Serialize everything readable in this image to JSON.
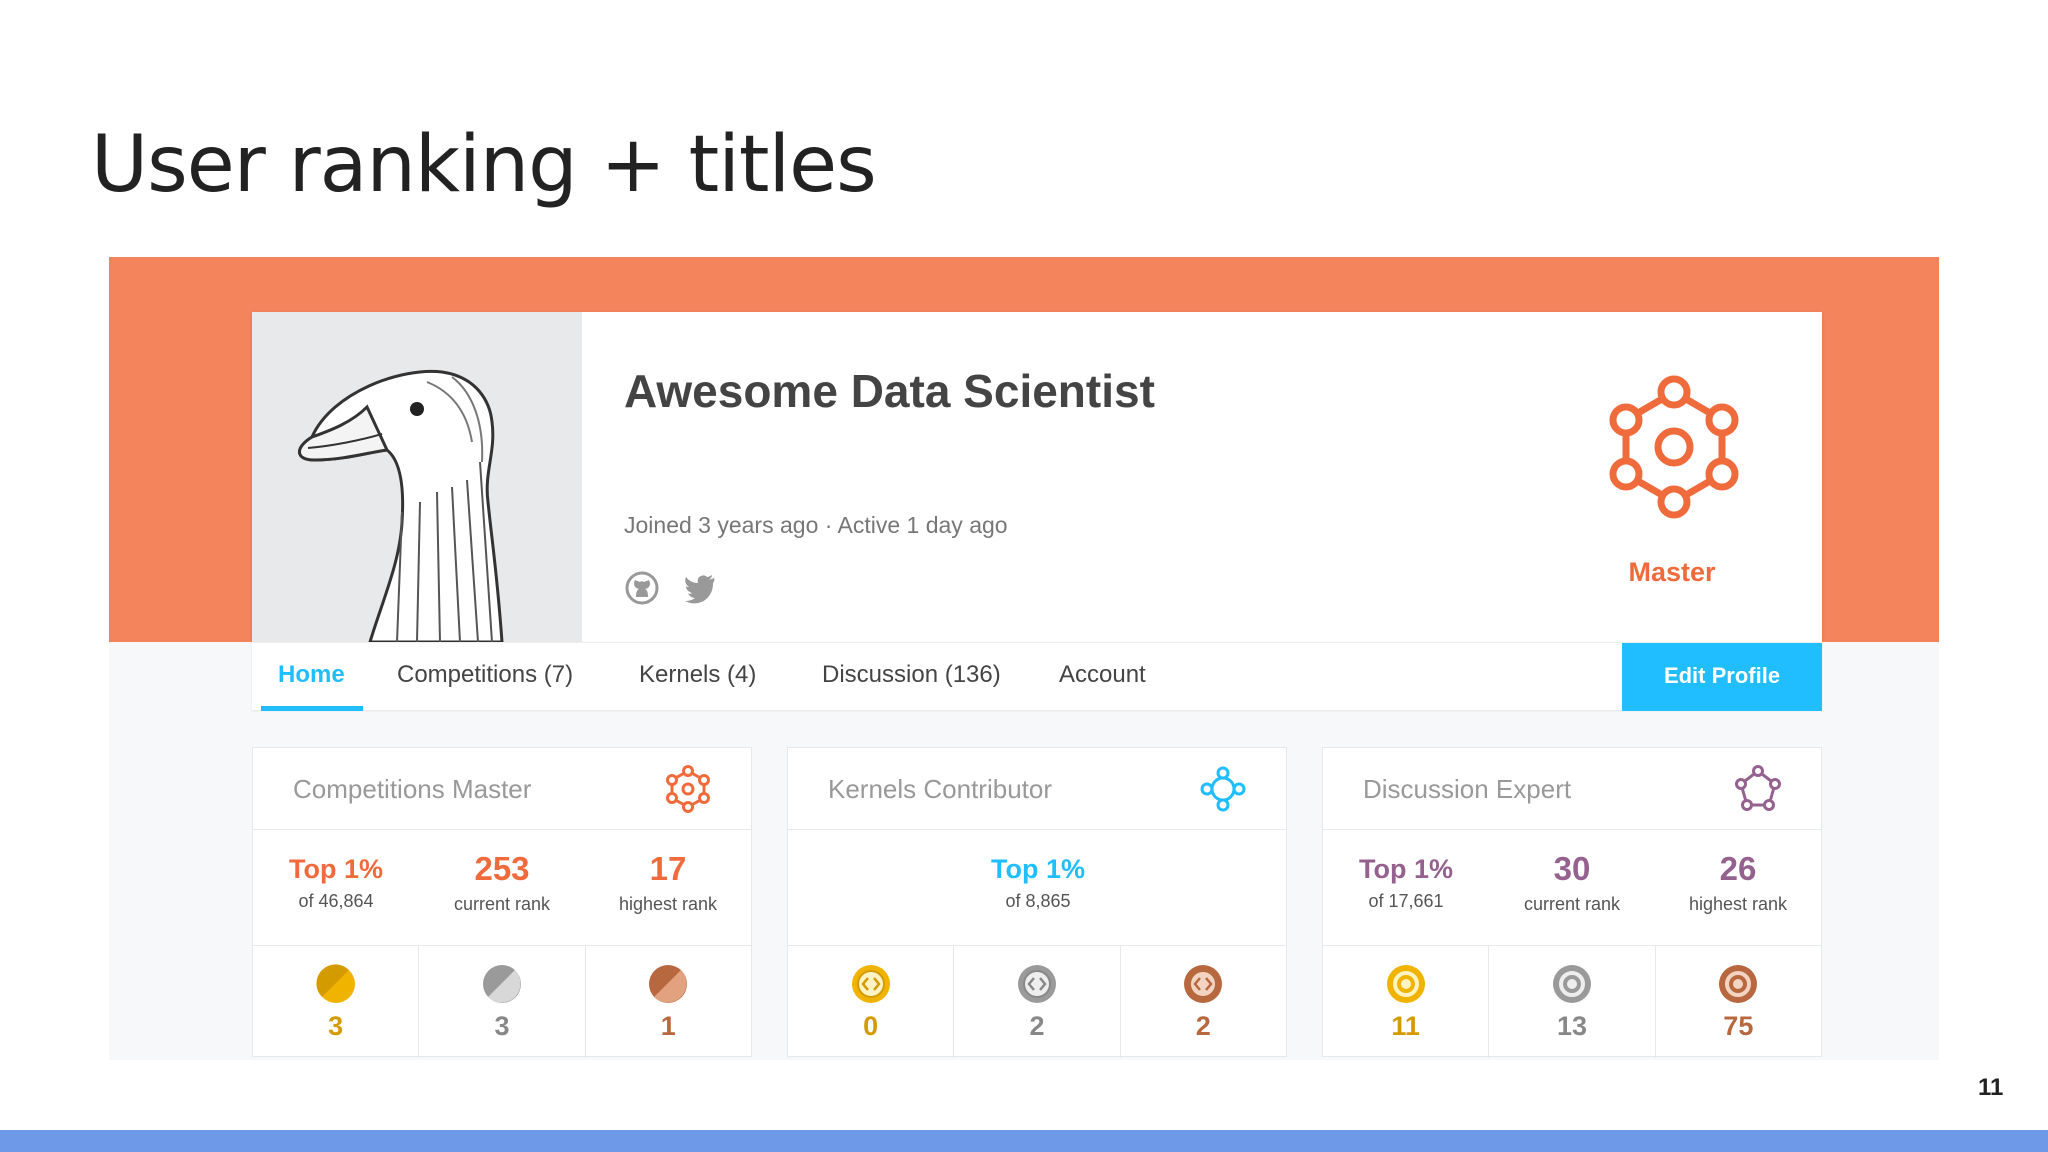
{
  "slide": {
    "title": "User ranking + titles",
    "page_number": "11"
  },
  "profile": {
    "name": "Awesome Data Scientist",
    "meta": "Joined 3 years ago · Active 1 day ago",
    "tier_label": "Master",
    "social_icons": [
      "github-icon",
      "twitter-icon"
    ]
  },
  "nav": {
    "items": [
      "Home",
      "Competitions (7)",
      "Kernels (4)",
      "Discussion (136)",
      "Account"
    ],
    "edit_label": "Edit Profile"
  },
  "colors": {
    "orange": "#f06b3c",
    "blue": "#20beff",
    "purple": "#95628f",
    "gold": "#f0b400",
    "silver": "#9a9a9a",
    "bronze": "#d07a4e"
  },
  "tiers": [
    {
      "title": "Competitions Master",
      "top": "Top 1%",
      "top_sub": "of 46,864",
      "current": "253",
      "current_sub": "current rank",
      "highest": "17",
      "highest_sub": "highest rank",
      "medals": [
        "3",
        "3",
        "1"
      ]
    },
    {
      "title": "Kernels Contributor",
      "top": "Top 1%",
      "top_sub": "of 8,865",
      "medals": [
        "0",
        "2",
        "2"
      ]
    },
    {
      "title": "Discussion Expert",
      "top": "Top 1%",
      "top_sub": "of 17,661",
      "current": "30",
      "current_sub": "current rank",
      "highest": "26",
      "highest_sub": "highest rank",
      "medals": [
        "11",
        "13",
        "75"
      ]
    }
  ]
}
